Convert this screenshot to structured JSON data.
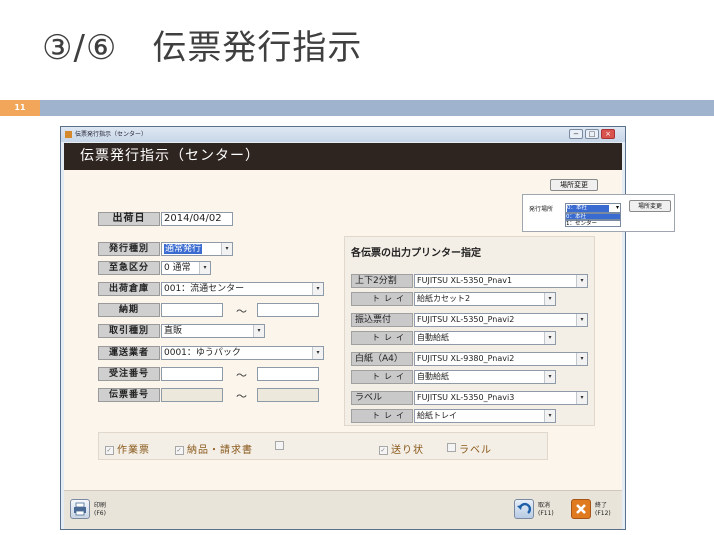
{
  "slide": {
    "title": "③/⑥　伝票発行指示",
    "page_number": "11"
  },
  "window": {
    "title": "伝票発行指示（センター）",
    "header": "伝票発行指示（センター）",
    "controls": {
      "minimize": "−",
      "maximize": "□",
      "close": "×"
    }
  },
  "location_button": "場所変更",
  "popup": {
    "label": "発行場所",
    "selected": "0：本社",
    "options": [
      "0：本社",
      "1：センター"
    ],
    "button": "場所変更"
  },
  "form": {
    "ship_date": {
      "label": "出荷日",
      "value": "2014/04/02"
    },
    "issue_type": {
      "label": "発行種別",
      "value": "通常発行"
    },
    "urgency": {
      "label": "至急区分",
      "value": "0 通常"
    },
    "warehouse": {
      "label": "出荷倉庫",
      "value": "001：流通センター"
    },
    "due_date": {
      "label": "納期",
      "from": "",
      "to": "",
      "sep": "〜"
    },
    "transaction_type": {
      "label": "取引種別",
      "value": "直販"
    },
    "carrier": {
      "label": "運送業者",
      "value": "0001：ゆうパック"
    },
    "order_no": {
      "label": "受注番号",
      "from": "",
      "to": "",
      "sep": "〜"
    },
    "slip_no": {
      "label": "伝票番号",
      "from": "",
      "to": "",
      "sep": "〜"
    }
  },
  "printers": {
    "title": "各伝票の出力プリンター指定",
    "tray_label": "トレイ",
    "rows": [
      {
        "label": "上下2分割",
        "printer": "FUJITSU XL-5350_Pnav1",
        "tray": "給紙カセット2"
      },
      {
        "label": "振込票付",
        "printer": "FUJITSU XL-5350_Pnavi2",
        "tray": "自動給紙"
      },
      {
        "label": "白紙（A4）",
        "printer": "FUJITSU XL-9380_Pnavi2",
        "tray": "自動給紙"
      },
      {
        "label": "ラベル",
        "printer": "FUJITSU XL-5350_Pnavi3",
        "tray": "給紙トレイ"
      }
    ]
  },
  "checkboxes": [
    {
      "label": "作業票",
      "checked": true
    },
    {
      "label": "納品・請求書",
      "checked": true
    },
    {
      "label": "",
      "checked": false
    },
    {
      "label": "送り状",
      "checked": true
    },
    {
      "label": "ラベル",
      "checked": false
    }
  ],
  "footer": {
    "print": {
      "label": "印刷",
      "key": "(F6)"
    },
    "cancel": {
      "label": "取消",
      "key": "(F11)"
    },
    "exit": {
      "label": "終了",
      "key": "(F12)"
    }
  },
  "colors": {
    "slide_bar": "#9fb3cf",
    "page_badge": "#f2a65a",
    "header_bg": "#2f2520",
    "form_bg": "#fbf5ec",
    "selected_blue": "#3a6bd1",
    "checkbox_text": "#8a5a1c"
  }
}
